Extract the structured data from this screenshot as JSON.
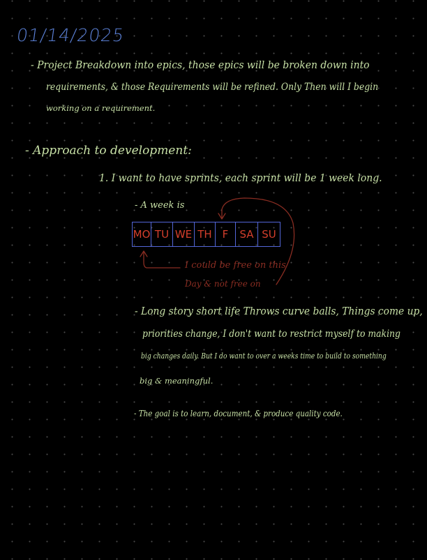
{
  "date": "01/14/2025",
  "bullet1": {
    "line1": "- Project Breakdown into epics, those epics will be broken down into",
    "line2": "requirements, & those Requirements will be refined. Only Then will I begin",
    "line3": "working on a requirement."
  },
  "bullet2": {
    "heading": "- Approach to development:",
    "item1": "1. I want to have sprints, each sprint will be 1 week long.",
    "week_label": "- A week is",
    "days": [
      "MO",
      "TU",
      "WE",
      "TH",
      "F",
      "SA",
      "SU"
    ],
    "note_line1": "I could be free on this",
    "note_line2": "Day & not free on",
    "long_story": {
      "line1": "- Long story short life Throws curve balls, Things come up,",
      "line2": "priorities change, I don't want to restrict myself to making",
      "line3": "big changes daily. But I do want to over a weeks time to build to something",
      "line4": "big & meaningful."
    },
    "goal": "- The goal is to learn, document, & produce quality code."
  },
  "colors": {
    "background": "#000000",
    "date_ink": "#5a7fd4",
    "main_ink": "#c7e0a6",
    "day_ink": "#d43f2c",
    "box_ink": "#5366d8",
    "note_ink": "#8a2d22"
  }
}
